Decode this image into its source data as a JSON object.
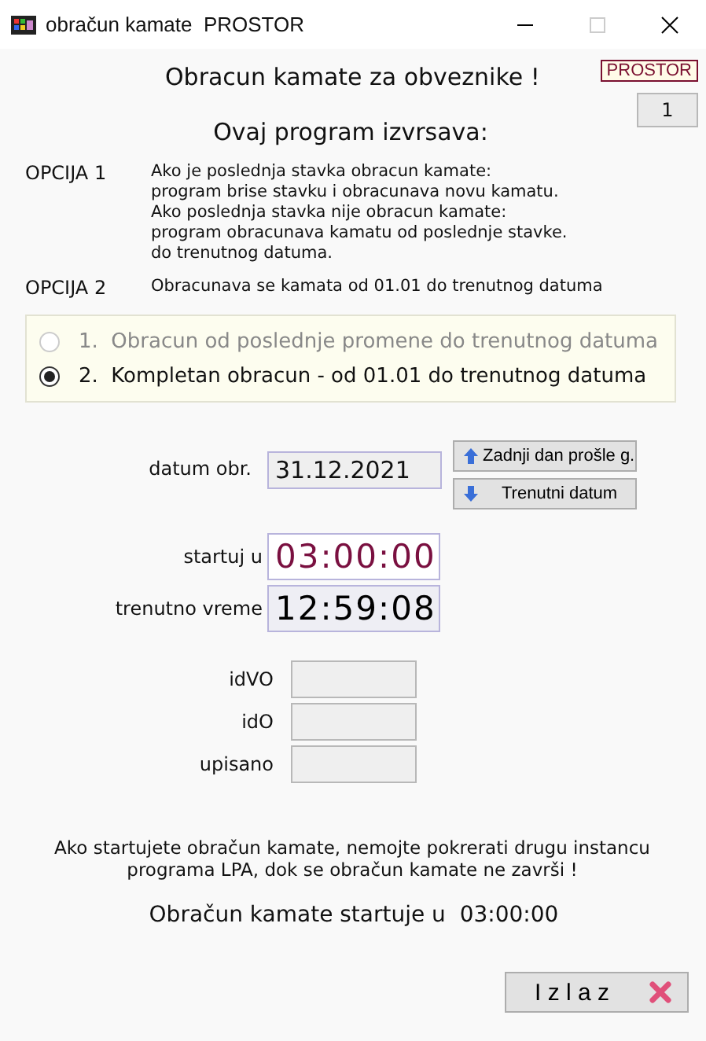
{
  "window": {
    "title": "obračun kamate  PROSTOR"
  },
  "header": {
    "title": "Obracun kamate za obveznike !",
    "badge": "PROSTOR",
    "counter": "1"
  },
  "intro": "Ovaj program izvrsava:",
  "options": [
    {
      "label": "OPCIJA 1",
      "lines": [
        "Ako je poslednja stavka obracun kamate:",
        "program brise stavku i obracunava novu kamatu.",
        "Ako poslednja stavka nije obracun kamate:",
        "program obracunava kamatu od poslednje stavke.",
        "do trenutnog datuma."
      ]
    },
    {
      "label": "OPCIJA 2",
      "lines": [
        "Obracunava se kamata od 01.01 do trenutnog datuma"
      ]
    }
  ],
  "modes": [
    {
      "number": "1.",
      "label": "Obracun od poslednje promene do trenutnog datuma",
      "selected": false,
      "disabled": true
    },
    {
      "number": "2.",
      "label": "Kompletan obracun - od 01.01 do trenutnog datuma",
      "selected": true,
      "disabled": false
    }
  ],
  "date": {
    "label": "datum obr.",
    "value": "31.12.2021"
  },
  "date_buttons": [
    {
      "label": "Zadnji dan prošle g.",
      "kind": "up"
    },
    {
      "label": "Trenutni datum",
      "kind": "down"
    }
  ],
  "start_time": {
    "label": "startuj u",
    "value": "03:00:00"
  },
  "current_time": {
    "label": "trenutno vreme",
    "value": "12:59:08"
  },
  "id_fields": [
    {
      "label": "idVO"
    },
    {
      "label": "idO"
    },
    {
      "label": "upisano"
    }
  ],
  "warning": "Ako startujete obračun kamate, nemojte pokrerati drugu instancu programa LPA, dok se obračun kamate ne završi !",
  "status": "Obračun kamate startuje u  03:00:00",
  "exit_button": {
    "label": "I z l a z"
  }
}
